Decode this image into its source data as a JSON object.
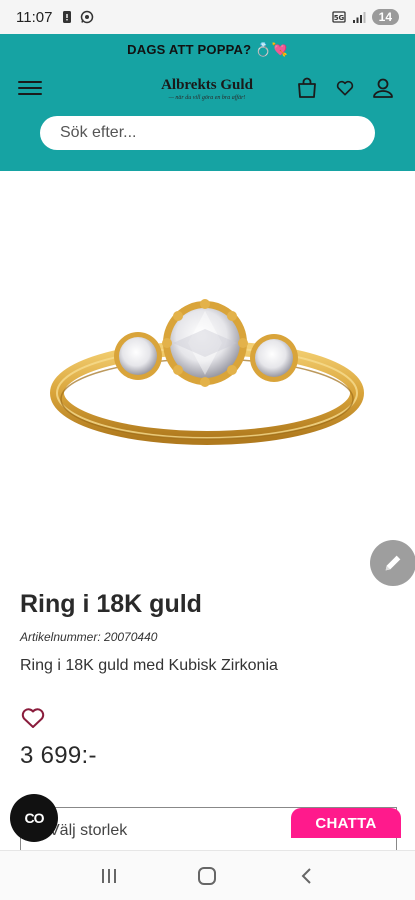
{
  "status_bar": {
    "time": "11:07",
    "battery": "14"
  },
  "header": {
    "promo_text": "DAGS ATT POPPA? 💍💘",
    "logo_text": "Albrekts Guld",
    "logo_tagline": "— när du vill göra en bra affär!",
    "search_placeholder": "Sök efter..."
  },
  "product": {
    "title": "Ring i 18K guld",
    "article_label": "Artikelnummer:",
    "article_number": "20070440",
    "description": "Ring i 18K guld med Kubisk Zirkonia",
    "price": "3 699:-",
    "size_placeholder": "Välj storlek"
  },
  "chat": {
    "chatta_label": "CHATTA",
    "fab_label": "CO"
  },
  "colors": {
    "header_bg": "#16a3a3",
    "chatta": "#ff1a8c",
    "heart": "#8a1c3c",
    "gold": "#d9a43a"
  }
}
